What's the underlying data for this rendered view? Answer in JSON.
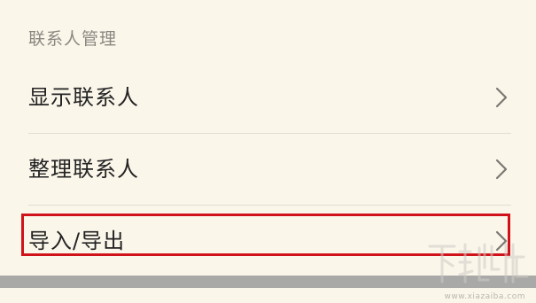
{
  "section": {
    "title": "联系人管理"
  },
  "menu": {
    "items": [
      {
        "label": "显示联系人"
      },
      {
        "label": "整理联系人"
      },
      {
        "label": "导入/导出"
      }
    ]
  },
  "watermark": {
    "brand": "下载吧",
    "url": "www.xiazaiba.com"
  },
  "colors": {
    "background": "#fbf6ea",
    "text": "#232323",
    "header_text": "#8a8781",
    "highlight": "#d0121b",
    "divider": "#e3ddd0"
  },
  "icons": {
    "chevron": "chevron-right-icon"
  }
}
